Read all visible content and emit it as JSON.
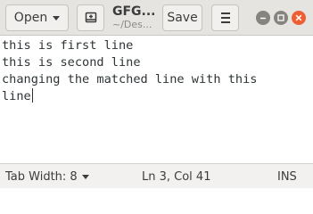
{
  "header": {
    "open_label": "Open",
    "new_tab_icon": "new-document-icon",
    "title": "GFG...",
    "subtitle": "~/Des...",
    "save_label": "Save",
    "menu_icon": "hamburger-menu-icon",
    "window_controls": [
      "minimize",
      "maximize",
      "close"
    ],
    "close_color": "#ee5e33"
  },
  "editor": {
    "lines": [
      "this is first line",
      "this is second line",
      "changing the matched line with this",
      "line"
    ]
  },
  "statusbar": {
    "tab_width": "Tab Width: 8",
    "position": "Ln 3, Col 41",
    "mode": "INS"
  }
}
